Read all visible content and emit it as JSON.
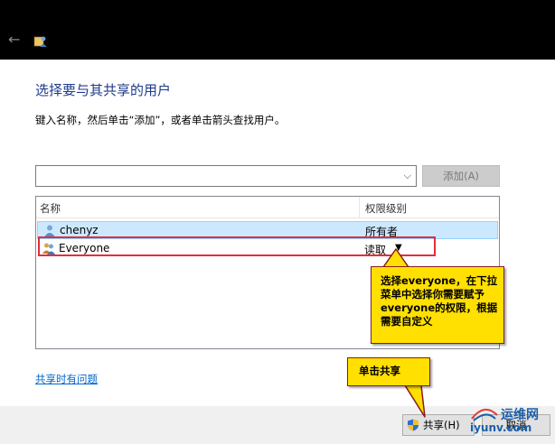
{
  "window": {
    "back_glyph": "←"
  },
  "dialog": {
    "heading": "选择要与其共享的用户",
    "instruction": "键入名称，然后单击“添加”，或者单击箭头查找用户。",
    "combo_value": "",
    "add_button": "添加(A)",
    "columns": [
      "名称",
      "权限级别"
    ],
    "rows": [
      {
        "name": "chenyz",
        "permission": "所有者",
        "selected": true
      },
      {
        "name": "Everyone",
        "permission": "读取",
        "selected": false
      }
    ],
    "help_link": "共享时有问题",
    "share_button": "共享(H)",
    "cancel_button": "取消"
  },
  "annotations": {
    "callout_permission": "选择everyone，在下拉菜单中选择你需要赋予everyone的权限，根据需要自定义",
    "callout_share": "单击共享",
    "highlight_color": "#e0303a",
    "callout_color": "#ffe000"
  },
  "watermark": {
    "title": "运维网",
    "url": "iyunv.com"
  }
}
